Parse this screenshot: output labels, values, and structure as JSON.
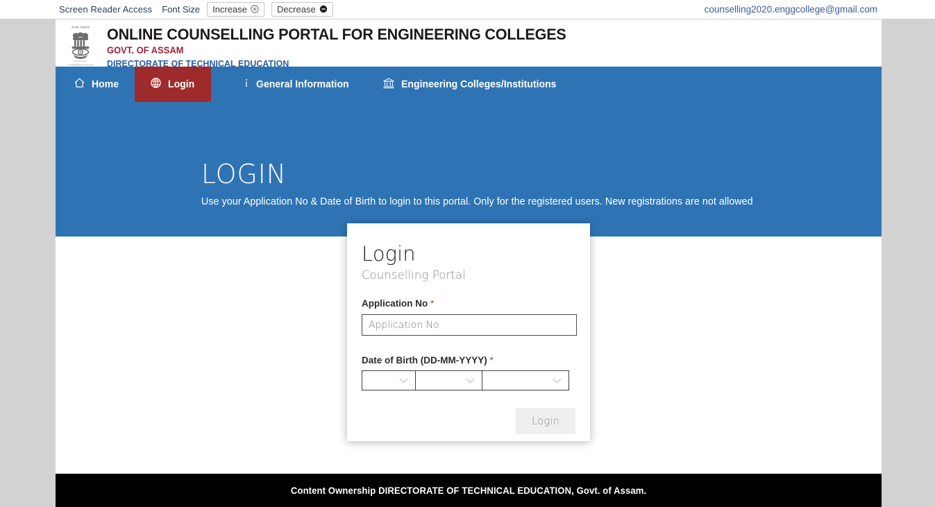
{
  "accessibility_bar": {
    "screen_reader_label": "Screen Reader Access",
    "font_size_label": "Font Size",
    "increase_label": "Increase",
    "decrease_label": "Decrease",
    "increase_icon": "circle-plus-icon",
    "decrease_icon": "circle-minus-icon",
    "email": "counselling2020.enggcollege@gmail.com"
  },
  "masthead": {
    "emblem_icon": "india-national-emblem-icon",
    "title": "ONLINE COUNSELLING PORTAL FOR ENGINEERING COLLEGES",
    "subtitle_1": "GOVT. OF ASSAM",
    "subtitle_2": "DIRECTORATE OF TECHNICAL EDUCATION"
  },
  "nav": {
    "items": [
      {
        "label": "Home",
        "icon": "home-icon",
        "active": false
      },
      {
        "label": "Login",
        "icon": "globe-icon",
        "active": true
      },
      {
        "label": "General Information",
        "icon": "info-icon",
        "active": false
      },
      {
        "label": "Engineering Colleges/Institutions",
        "icon": "bank-institution-icon",
        "active": false
      }
    ]
  },
  "hero": {
    "title": "LOGIN",
    "subtitle": "Use your Application No & Date of Birth to login to this portal. Only for the registered users. New registrations are not allowed"
  },
  "login_card": {
    "title": "Login",
    "subtitle": "Counselling Portal",
    "application_no": {
      "label": "Application No",
      "required_mark": "*",
      "placeholder": "Application No",
      "value": ""
    },
    "date_of_birth": {
      "label": "Date of Birth (DD-MM-YYYY)",
      "required_mark": "*",
      "day_value": "",
      "month_value": "",
      "year_value": "",
      "chevron_icon": "chevron-down-icon"
    },
    "submit_label": "Login"
  },
  "footer": {
    "text": "Content Ownership DIRECTORATE OF TECHNICAL EDUCATION, Govt. of Assam."
  },
  "colors": {
    "nav_blue": "#2e74b5",
    "active_red": "#9e2b2b",
    "accent_maroon": "#9d2235",
    "accent_blue": "#2a5c9e",
    "page_background": "#d2d2d2",
    "footer_black": "#000000"
  }
}
